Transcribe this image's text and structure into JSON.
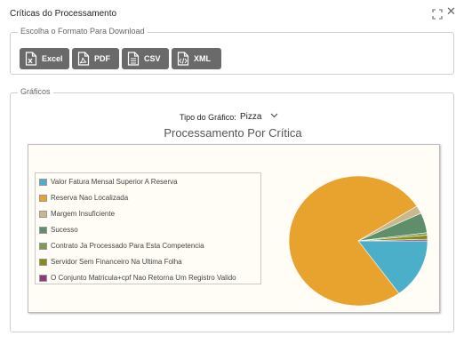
{
  "dialog": {
    "title": "Críticas do Processamento"
  },
  "download": {
    "legend": "Escolha o Formato Para Download",
    "buttons": [
      {
        "label": "Excel",
        "icon": "excel-file-icon"
      },
      {
        "label": "PDF",
        "icon": "pdf-file-icon"
      },
      {
        "label": "CSV",
        "icon": "csv-file-icon"
      },
      {
        "label": "XML",
        "icon": "xml-file-icon"
      }
    ]
  },
  "charts": {
    "legend": "Gráficos",
    "type_label": "Tipo do Gráfico:",
    "type_value": "Pizza"
  },
  "chart_data": {
    "type": "pie",
    "title": "Processamento Por Crítica",
    "legend_position": "left",
    "slices": [
      {
        "name": "Valor Fatura Mensal Superior A Reserva",
        "value": 15,
        "color": "#4bafc9"
      },
      {
        "name": "Reserva Nao Localizada",
        "value": 76,
        "color": "#e8a22e"
      },
      {
        "name": "Margem Insuficiente",
        "value": 2,
        "color": "#c9b88e"
      },
      {
        "name": "Sucesso",
        "value": 5,
        "color": "#5e8f6a"
      },
      {
        "name": "Contrato Ja Processado Para Esta Competencia",
        "value": 0.6,
        "color": "#7f9a55"
      },
      {
        "name": "Servidor Sem Financeiro Na Ultima Folha",
        "value": 1,
        "color": "#8a8b16"
      },
      {
        "name": "O Conjunto Matricula+cpf Nao Retorna Um Registro Valido",
        "value": 0.4,
        "color": "#8e3a7a"
      }
    ]
  }
}
